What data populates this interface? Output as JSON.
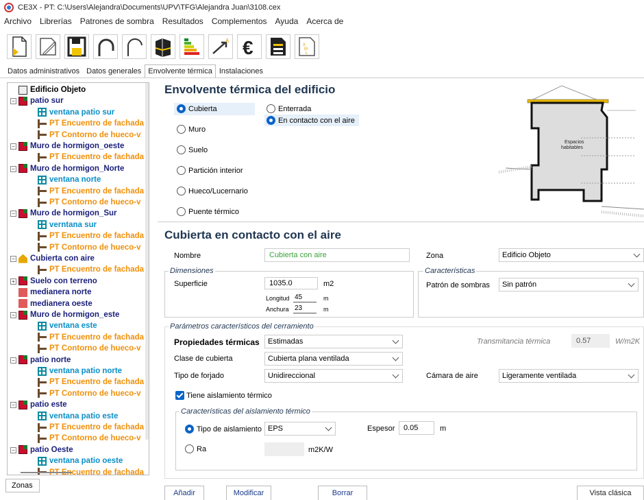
{
  "window": {
    "title": "CE3X - PT: C:\\Users\\Alejandra\\Documents\\UPV\\TFG\\Alejandra Juan\\3108.cex"
  },
  "menu": [
    "Archivo",
    "Librerías",
    "Patrones de sombra",
    "Resultados",
    "Complementos",
    "Ayuda",
    "Acerca de"
  ],
  "toolbar": {
    "icons": [
      "new-file-icon",
      "open-file-icon",
      "save-icon",
      "undo-icon",
      "redo-icon",
      "building-3d-icon",
      "energy-rating-icon",
      "improvement-measures-icon",
      "euro-icon",
      "report-icon",
      "xml-export-icon"
    ]
  },
  "tabs": [
    "Datos administrativos",
    "Datos generales",
    "Envolvente térmica",
    "Instalaciones"
  ],
  "tree": [
    {
      "label": "Edificio Objeto",
      "level": 0,
      "icon": "building",
      "color": "black"
    },
    {
      "label": "patio sur",
      "level": 0,
      "icon": "wall",
      "color": "navy",
      "expander": "−"
    },
    {
      "label": "ventana patio sur",
      "level": 1,
      "icon": "window",
      "color": "blue"
    },
    {
      "label": "PT Encuentro de fachada",
      "level": 1,
      "icon": "pt",
      "color": "orange"
    },
    {
      "label": "PT Contorno de hueco-v",
      "level": 1,
      "icon": "pt",
      "color": "orange"
    },
    {
      "label": "Muro de hormigon_oeste",
      "level": 0,
      "icon": "wall",
      "color": "navy",
      "expander": "−"
    },
    {
      "label": "PT Encuentro de fachada",
      "level": 1,
      "icon": "pt",
      "color": "orange"
    },
    {
      "label": "Muro de hormigon_Norte",
      "level": 0,
      "icon": "wall",
      "color": "navy",
      "expander": "−"
    },
    {
      "label": "ventana norte",
      "level": 1,
      "icon": "window",
      "color": "blue"
    },
    {
      "label": "PT Encuentro de fachada",
      "level": 1,
      "icon": "pt",
      "color": "orange"
    },
    {
      "label": "PT Contorno de hueco-v",
      "level": 1,
      "icon": "pt",
      "color": "orange"
    },
    {
      "label": "Muro de hormigon_Sur",
      "level": 0,
      "icon": "wall",
      "color": "navy",
      "expander": "−"
    },
    {
      "label": "verntana sur",
      "level": 1,
      "icon": "window",
      "color": "blue"
    },
    {
      "label": "PT Encuentro de fachada",
      "level": 1,
      "icon": "pt",
      "color": "orange"
    },
    {
      "label": "PT Contorno de hueco-v",
      "level": 1,
      "icon": "pt",
      "color": "orange"
    },
    {
      "label": "Cubierta con aire",
      "level": 0,
      "icon": "roof",
      "color": "navy",
      "expander": "−"
    },
    {
      "label": "PT Encuentro de fachada",
      "level": 1,
      "icon": "pt",
      "color": "orange"
    },
    {
      "label": "Suelo con terreno",
      "level": 0,
      "icon": "wall",
      "color": "navy",
      "expander": "+"
    },
    {
      "label": "medianera norte",
      "level": 0,
      "icon": "med",
      "color": "navy"
    },
    {
      "label": "medianera oeste",
      "level": 0,
      "icon": "med",
      "color": "navy"
    },
    {
      "label": "Muro de hormigon_este",
      "level": 0,
      "icon": "wall",
      "color": "navy",
      "expander": "−"
    },
    {
      "label": "ventana este",
      "level": 1,
      "icon": "window",
      "color": "blue"
    },
    {
      "label": "PT Encuentro de fachada",
      "level": 1,
      "icon": "pt",
      "color": "orange"
    },
    {
      "label": "PT Contorno de hueco-v",
      "level": 1,
      "icon": "pt",
      "color": "orange"
    },
    {
      "label": "patio norte",
      "level": 0,
      "icon": "wall",
      "color": "navy",
      "expander": "−"
    },
    {
      "label": "ventana patio norte",
      "level": 1,
      "icon": "window",
      "color": "blue"
    },
    {
      "label": "PT Encuentro de fachada",
      "level": 1,
      "icon": "pt",
      "color": "orange"
    },
    {
      "label": "PT Contorno de hueco-v",
      "level": 1,
      "icon": "pt",
      "color": "orange"
    },
    {
      "label": "patio este",
      "level": 0,
      "icon": "wall",
      "color": "navy",
      "expander": "−"
    },
    {
      "label": "ventana patio este",
      "level": 1,
      "icon": "window",
      "color": "blue"
    },
    {
      "label": "PT Encuentro de fachada",
      "level": 1,
      "icon": "pt",
      "color": "orange"
    },
    {
      "label": "PT Contorno de hueco-v",
      "level": 1,
      "icon": "pt",
      "color": "orange"
    },
    {
      "label": "patio Oeste",
      "level": 0,
      "icon": "wall",
      "color": "navy",
      "expander": "−"
    },
    {
      "label": "ventana patio oeste",
      "level": 1,
      "icon": "window",
      "color": "blue"
    },
    {
      "label": "PT Encuentro de fachada",
      "level": 1,
      "icon": "pt",
      "color": "orange"
    }
  ],
  "zonas_button": "Zonas",
  "section1": {
    "title": "Envolvente térmica del edificio",
    "types": [
      "Cubierta",
      "Muro",
      "Suelo",
      "Partición interior",
      "Hueco/Lucernario",
      "Puente térmico"
    ],
    "selected_type": "Cubierta",
    "subtypes": [
      "Enterrada",
      "En contacto con el aire"
    ],
    "selected_subtype": "En contacto con el aire",
    "diagram_label": "Espacios habitables"
  },
  "section2": {
    "title": "Cubierta en contacto con el aire",
    "nombre_label": "Nombre",
    "nombre_value": "Cubierta con aire",
    "zona_label": "Zona",
    "zona_value": "Edificio Objeto",
    "dimensiones_title": "Dimensiones",
    "superficie_label": "Superficie",
    "superficie_value": "1035.0",
    "superficie_unit": "m2",
    "longitud_label": "Longitud",
    "longitud_value": "45",
    "longitud_unit": "m",
    "anchura_label": "Anchura",
    "anchura_value": "23",
    "anchura_unit": "m",
    "caracteristicas_title": "Características",
    "patron_label": "Patrón de sombras",
    "patron_value": "Sin patrón",
    "parametros_title": "Parámetros característicos del cerramiento",
    "propiedades_label": "Propiedades térmicas",
    "propiedades_value": "Estimadas",
    "transmitancia_label": "Transmitancia térmica",
    "transmitancia_value": "0.57",
    "transmitancia_unit": "W/m2K",
    "clase_label": "Clase de cubierta",
    "clase_value": "Cubierta plana ventilada",
    "forjado_label": "Tipo de forjado",
    "forjado_value": "Unidireccional",
    "camara_label": "Cámara de aire",
    "camara_value": "Ligeramente ventilada",
    "aislamiento_check_label": "Tiene aislamiento térmico",
    "aislamiento_checked": true,
    "aislamiento_group_title": "Características del aislamiento térmico",
    "tipo_aislamiento_label": "Tipo de aislamiento",
    "tipo_aislamiento_value": "EPS",
    "espesor_label": "Espesor",
    "espesor_value": "0.05",
    "espesor_unit": "m",
    "ra_label": "Ra",
    "ra_unit": "m2K/W"
  },
  "buttons": {
    "anadir": "Añadir",
    "modificar": "Modificar",
    "borrar": "Borrar",
    "vista_clasica": "Vista clásica"
  },
  "colors": {
    "selected_radio": "#0a63c7",
    "section_title": "#1f3550",
    "tree_navy": "#1a1f7a",
    "tree_blue": "#0b8fc7",
    "tree_orange": "#f0900a",
    "nombre_green": "#3aa23a"
  }
}
